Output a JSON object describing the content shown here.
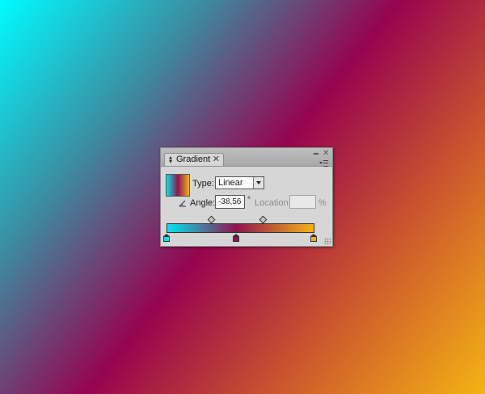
{
  "panel": {
    "tab_label": "Gradient",
    "type": {
      "label": "Type:",
      "selected": "Linear"
    },
    "angle": {
      "label": "Angle:",
      "value": "-38,56",
      "unit": "°"
    },
    "location": {
      "label": "Location:",
      "value": "",
      "unit": "%"
    }
  },
  "colors": {
    "stop_left": "#00e5f0",
    "stop_mid": "#92124e",
    "stop_right": "#f4b313"
  },
  "icons": {
    "tab_toggle": "double-arrow-icon",
    "tab_close": "close-icon",
    "minimize": "minimize-icon",
    "close": "close-icon",
    "menu": "panel-menu-icon",
    "angle": "angle-icon",
    "resize": "resize-grip-icon"
  }
}
